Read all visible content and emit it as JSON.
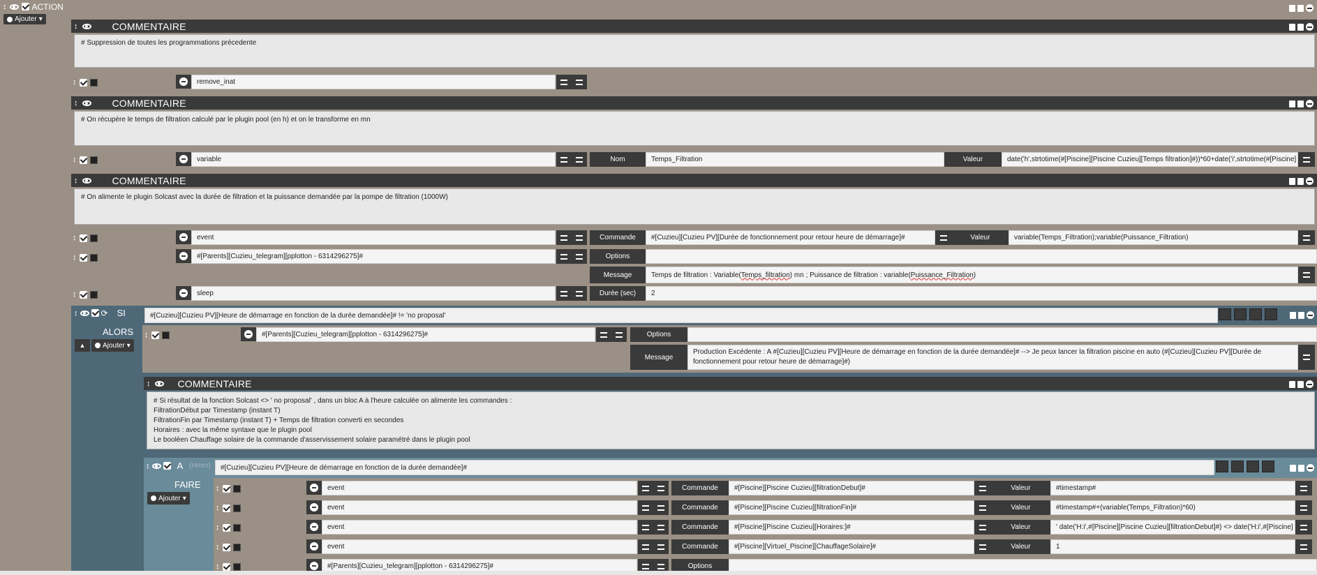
{
  "action_header": {
    "title": "ACTION",
    "add_label": "Ajouter"
  },
  "comment1": {
    "title": "COMMENTAIRE",
    "text": "# Suppression de toutes les programmations précedente"
  },
  "row_remove": {
    "value": "remove_inat"
  },
  "comment2": {
    "title": "COMMENTAIRE",
    "text": "# On récupère le temps de filtration calculé par le plugin pool (en h) et on le transforme en mn"
  },
  "row_variable": {
    "value": "variable",
    "nom_label": "Nom",
    "nom_value": "Temps_Filtration",
    "valeur_label": "Valeur",
    "valeur_value": "date('h',strtotime(#[Piscine][Piscine Cuzieu][Temps filtration]#))*60+date('i',strtotime(#[Piscine]"
  },
  "comment3": {
    "title": "COMMENTAIRE",
    "text": "# On alimente le plugin Solcast avec la durée de filtration et la puissance demandée par la pompe de filtration (1000W)"
  },
  "row_event": {
    "value": "event",
    "cmd_label": "Commande",
    "cmd_value": "#[Cuzieu][Cuzieu PV][Durée de fonctionnement pour retour heure de démarrage]#",
    "valeur_label": "Valeur",
    "valeur_value": "variable(Temps_Filtration);variable(Puissance_Filtration)"
  },
  "row_telegram": {
    "value": "#[Parents][Cuzieu_telegram][pplotton - 6314296275]#",
    "options_label": "Options",
    "message_label": "Message",
    "message_prefix": "Temps de filtration : Variable(",
    "message_var1": "Temps_filtration",
    "message_mid": ") mn ; Puissance de filtration : variable(",
    "message_var2": "Puissance_Filtration",
    "message_suffix": ")"
  },
  "row_sleep": {
    "value": "sleep",
    "duree_label": "Durée (sec)",
    "duree_value": "2"
  },
  "si_block": {
    "si_label": "SI",
    "alors_label": "ALORS",
    "add_label": "Ajouter",
    "condition": "#[Cuzieu][Cuzieu PV][Heure de démarrage en fonction de la durée demandée]# != 'no proposal'",
    "telegram": {
      "value": "#[Parents][Cuzieu_telegram][pplotton - 6314296275]#",
      "options_label": "Options",
      "message_label": "Message",
      "message_value": "Production Excédente : A  #[Cuzieu][Cuzieu PV][Heure de démarrage en fonction de la durée demandée]# --> Je peux lancer la filtration piscine en auto (#[Cuzieu][Cuzieu PV][Durée de fonctionnement pour retour heure de démarrage]#)"
    },
    "comment": {
      "title": "COMMENTAIRE",
      "lines": "# Si résultat de la fonction Solcast <> ' no proposal' , dans un bloc A à l'heure calculée on alimente les commandes :\nFiltrationDébut par Timestamp (instant T)\nFiltrationFin par Timestamp (instant T) + Temps de filtration converti en secondes\nHoraires : avec la même syntaxe que le plugin pool\nLe booléen Chauffage solaire de la commande d'asservissement solaire paramétré dans le plugin pool"
    },
    "a_block": {
      "a_label": "A",
      "a_hint": "(Hmm)",
      "faire_label": "FAIRE",
      "add_label": "Ajouter",
      "condition": "#[Cuzieu][Cuzieu PV][Heure de démarrage en fonction de la durée demandée]#",
      "rows": [
        {
          "value": "event",
          "cmd_label": "Commande",
          "cmd_value": "#[Piscine][Piscine Cuzieu][filtrationDebut]#",
          "valeur_label": "Valeur",
          "valeur_value": "#timestamp#"
        },
        {
          "value": "event",
          "cmd_label": "Commande",
          "cmd_value": "#[Piscine][Piscine Cuzieu][filtrationFin]#",
          "valeur_label": "Valeur",
          "valeur_value": "#timestamp#+(variable(Temps_Filtration)*60)"
        },
        {
          "value": "event",
          "cmd_label": "Commande",
          "cmd_value": "#[Piscine][Piscine Cuzieu][Horaires:]#",
          "valeur_label": "Valeur",
          "valeur_value": "' date('H:i',#[Piscine][Piscine Cuzieu][filtrationDebut]#) <> date('H:i',#[Piscine]"
        },
        {
          "value": "event",
          "cmd_label": "Commande",
          "cmd_value": "#[Piscine][Virtuel_Piscine][ChauffageSolaire]#",
          "valeur_label": "Valeur",
          "valeur_value": "1"
        }
      ],
      "last_row": {
        "value": "#[Parents][Cuzieu_telegram][pplotton - 6314296275]#",
        "options_label": "Options"
      }
    }
  }
}
